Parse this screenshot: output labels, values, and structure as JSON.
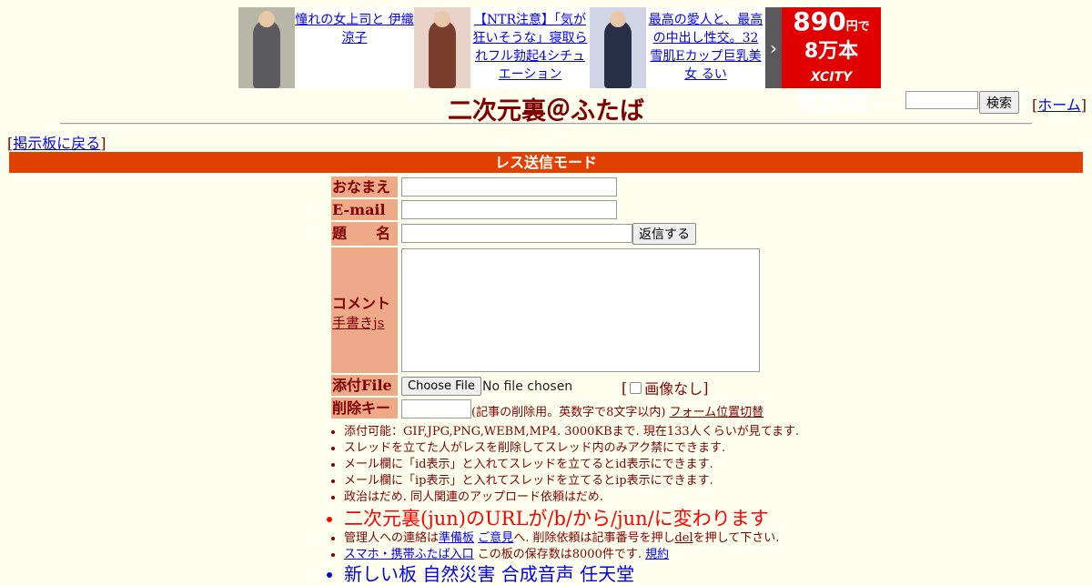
{
  "ads": [
    {
      "text": "憧れの女上司と 伊織涼子",
      "img_color": "#b7b7a8",
      "img_accent": "#5c5c60"
    },
    {
      "text": "【NTR注意】「気が狂いそうな」寝取られフル勃起4シチュエーション",
      "img_color": "#e9d2c8",
      "img_accent": "#7a3d2e"
    },
    {
      "text": "最高の愛人と、最高の中出し性交。32 雪肌Eカップ巨乳美女 るい",
      "img_color": "#cfd5e6",
      "img_accent": "#2a2f48"
    }
  ],
  "ad_promo": {
    "price": "890",
    "unit": "円で",
    "count": "8万本",
    "brand": "XCITY",
    "tagline": "見放題"
  },
  "ad_arrow": "›",
  "search": {
    "button": "検索",
    "value": ""
  },
  "home": {
    "open": "[",
    "label": "ホーム",
    "close": "]"
  },
  "title": "二次元裏＠ふたば",
  "back": {
    "open": "[",
    "label": "掲示板に戻る",
    "close": "]"
  },
  "mode": "レス送信モード",
  "form": {
    "name_label": "おなまえ",
    "email_label": "E-mail",
    "subject_label": "題　　名",
    "submit": "返信する",
    "comment_label": "コメント",
    "handwrite": "手書きjs",
    "file_label": "添付File",
    "file_button": "Choose File",
    "file_status": "No file chosen",
    "noimg_open": "[",
    "noimg_label": "画像なし",
    "noimg_close": "]",
    "delkey_label": "削除キー",
    "delkey_note": "(記事の削除用。英数字で8文字以内)",
    "form_switch": "フォーム位置切替"
  },
  "notes": {
    "n1": "添付可能：GIF,JPG,PNG,WEBM,MP4. 3000KBまで. 現在133人くらいが見てます.",
    "n2": "スレッドを立てた人がレスを削除してスレッド内のみアク禁にできます.",
    "n3": "メール欄に「id表示」と入れてスレッドを立てるとid表示にできます.",
    "n4": "メール欄に「ip表示」と入れてスレッドを立てるとip表示にできます.",
    "n5": "政治はだめ. 同人関連のアップロード依頼はだめ.",
    "n6": "二次元裏(jun)のURLが/b/から/jun/に変わります",
    "n7_pre": "管理人への連絡は",
    "n7_link1": "準備板",
    "n7_link2": "ご意見",
    "n7_mid": "へ. 削除依頼は記事番号を押し",
    "n7_del": "del",
    "n7_post": "を押して下さい.",
    "n8_link": "スマホ・携帯ふたば入口",
    "n8_mid": " この板の保存数は8000件です. ",
    "n8_link2": "規約",
    "n9": "新しい板 自然災害 合成音声 任天堂"
  }
}
